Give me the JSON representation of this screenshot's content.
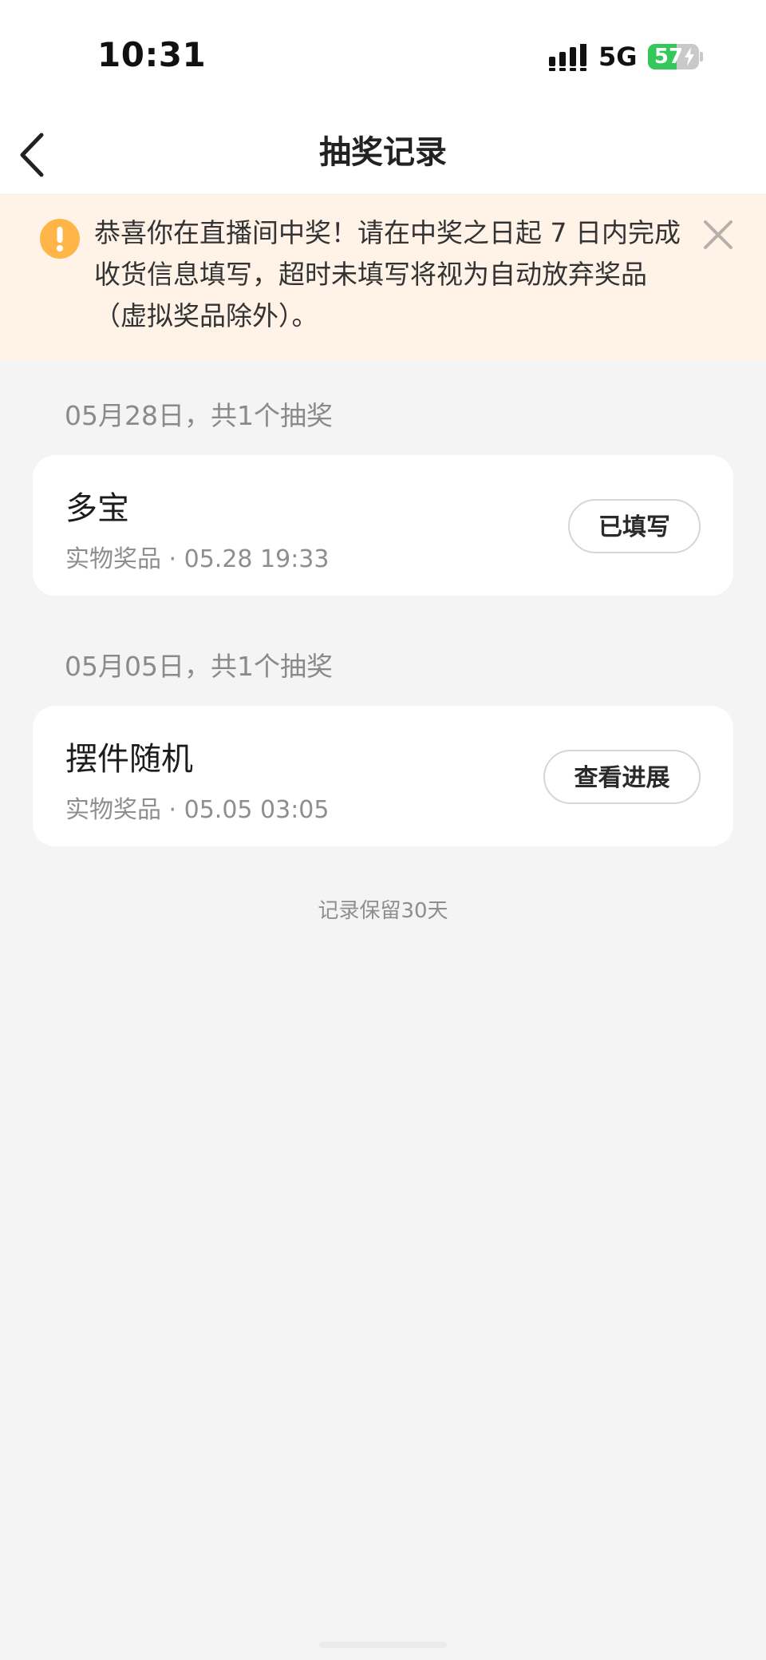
{
  "status_bar": {
    "time": "10:31",
    "network": "5G",
    "battery_level": "57",
    "battery_percent": 57,
    "icons": [
      "signal-icon",
      "battery-icon",
      "charging-bolt-icon"
    ]
  },
  "nav": {
    "title": "抽奖记录",
    "back_icon": "chevron-left-icon"
  },
  "notice": {
    "text": "恭喜你在直播间中奖！请在中奖之日起 7 日内完成收货信息填写，超时未填写将视为自动放弃奖品（虚拟奖品除外）。",
    "icon": "warning-icon",
    "close_icon": "close-icon",
    "icon_color": "#ffb547"
  },
  "groups": [
    {
      "date_header": "05月28日，共1个抽奖",
      "item": {
        "name": "多宝",
        "meta": "实物奖品 · 05.28 19:33",
        "action_label": "已填写"
      }
    },
    {
      "date_header": "05月05日，共1个抽奖",
      "item": {
        "name": "摆件随机",
        "meta": "实物奖品 · 05.05 03:05",
        "action_label": "查看进展"
      }
    }
  ],
  "footer": {
    "note": "记录保留30天"
  },
  "colors": {
    "background": "#f4f4f4",
    "notice_background": "#fff3e8",
    "battery_green": "#34c759"
  }
}
